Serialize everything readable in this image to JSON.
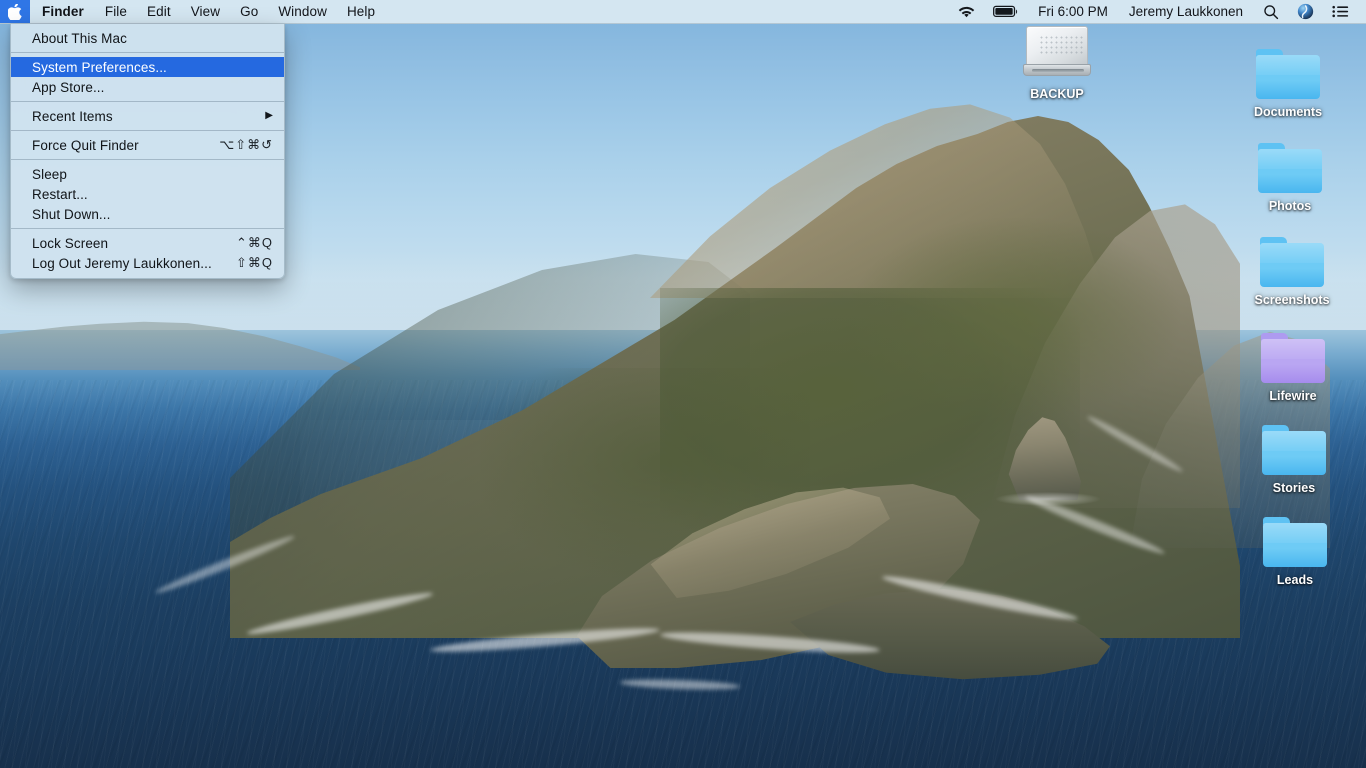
{
  "menubar": {
    "apple_icon": "apple-logo-icon",
    "app_name": "Finder",
    "menus": [
      "File",
      "Edit",
      "View",
      "Go",
      "Window",
      "Help"
    ],
    "status": {
      "wifi_icon": "wifi-icon",
      "battery_icon": "battery-icon",
      "datetime": "Fri 6:00 PM",
      "user": "Jeremy Laukkonen",
      "search_icon": "search-icon",
      "siri_icon": "siri-icon",
      "control_center_icon": "control-center-icon"
    }
  },
  "apple_menu": {
    "items": [
      {
        "label": "About This Mac",
        "shortcut": "",
        "selected": false,
        "submenu": false
      },
      {
        "label": "System Preferences...",
        "shortcut": "",
        "selected": true,
        "submenu": false
      },
      {
        "label": "App Store...",
        "shortcut": "",
        "selected": false,
        "submenu": false
      },
      {
        "label": "Recent Items",
        "shortcut": "",
        "selected": false,
        "submenu": true
      },
      {
        "label": "Force Quit Finder",
        "shortcut": "⌥⇧⌘↺",
        "selected": false,
        "submenu": false
      },
      {
        "label": "Sleep",
        "shortcut": "",
        "selected": false,
        "submenu": false
      },
      {
        "label": "Restart...",
        "shortcut": "",
        "selected": false,
        "submenu": false
      },
      {
        "label": "Shut Down...",
        "shortcut": "",
        "selected": false,
        "submenu": false
      },
      {
        "label": "Lock Screen",
        "shortcut": "⌃⌘Q",
        "selected": false,
        "submenu": false
      },
      {
        "label": "Log Out Jeremy Laukkonen...",
        "shortcut": "⇧⌘Q",
        "selected": false,
        "submenu": false
      }
    ],
    "highlight_color": "#2569e0"
  },
  "desktop": {
    "drive": {
      "label": "BACKUP",
      "icon": "hard-drive-icon"
    },
    "folders": [
      {
        "label": "Documents",
        "color": "#6ecbf5",
        "dark": "#49b6ef",
        "tab": "#5ec2f3"
      },
      {
        "label": "Photos",
        "color": "#6ecbf5",
        "dark": "#49b6ef",
        "tab": "#5ec2f3"
      },
      {
        "label": "Screenshots",
        "color": "#6ecbf5",
        "dark": "#49b6ef",
        "tab": "#5ec2f3"
      },
      {
        "label": "Lifewire",
        "color": "#b9a6f2",
        "dark": "#a68ced",
        "tab": "#ae9bf0"
      },
      {
        "label": "Stories",
        "color": "#6ecbf5",
        "dark": "#49b6ef",
        "tab": "#5ec2f3"
      },
      {
        "label": "Leads",
        "color": "#6ecbf5",
        "dark": "#49b6ef",
        "tab": "#5ec2f3"
      }
    ]
  }
}
